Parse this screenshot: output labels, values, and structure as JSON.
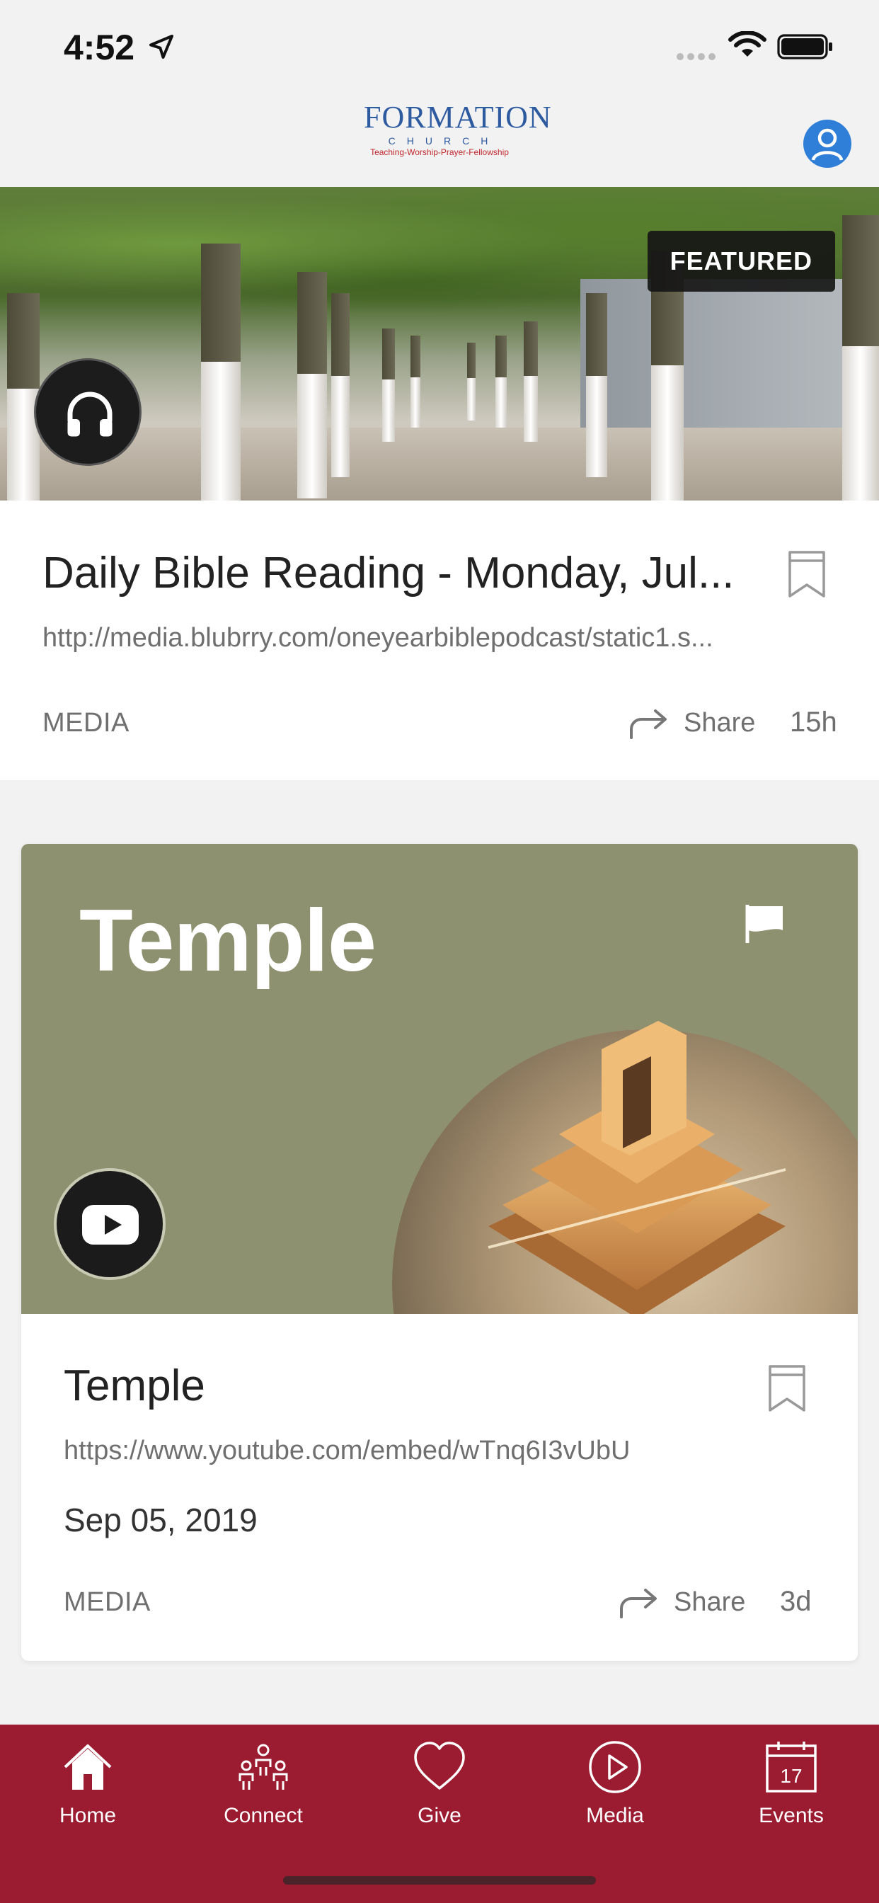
{
  "status_bar": {
    "time": "4:52"
  },
  "header": {
    "logo_word": "FORMATION",
    "logo_sub": "CHURCH",
    "logo_tag": "Teaching-Worship-Prayer-Fellowship"
  },
  "featured_card": {
    "badge": "FEATURED",
    "title": "Daily Bible Reading - Monday, Jul...",
    "url": "http://media.blubrry.com/oneyearbiblepodcast/static1.s...",
    "category": "MEDIA",
    "share_label": "Share",
    "age": "15h",
    "media_icon": "headphones-icon"
  },
  "media_card": {
    "image_heading": "Temple",
    "title": "Temple",
    "url": "https://www.youtube.com/embed/wTnq6I3vUbU",
    "date": "Sep 05, 2019",
    "category": "MEDIA",
    "share_label": "Share",
    "age": "3d",
    "media_icon": "youtube-icon"
  },
  "tab_bar": {
    "color": "#9b1b30",
    "tabs": [
      {
        "label": "Home",
        "icon": "home-icon"
      },
      {
        "label": "Connect",
        "icon": "people-icon"
      },
      {
        "label": "Give",
        "icon": "heart-icon"
      },
      {
        "label": "Media",
        "icon": "play-icon"
      },
      {
        "label": "Events",
        "icon": "calendar-icon",
        "calendar_day": "17"
      }
    ]
  }
}
